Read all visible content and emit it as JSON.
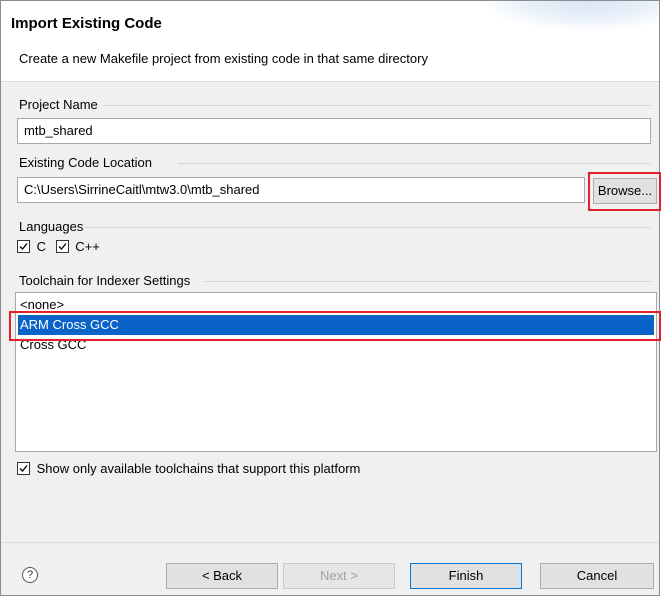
{
  "header": {
    "title": "Import Existing Code",
    "subtitle": "Create a new Makefile project from existing code in that same directory"
  },
  "project_name": {
    "label": "Project Name",
    "value": "mtb_shared"
  },
  "code_location": {
    "label": "Existing Code Location",
    "value": "C:\\Users\\SirrineCaitl\\mtw3.0\\mtb_shared",
    "browse_label": "Browse..."
  },
  "languages": {
    "label": "Languages",
    "items": [
      {
        "label": "C",
        "checked": true
      },
      {
        "label": "C++",
        "checked": true
      }
    ]
  },
  "toolchain": {
    "label": "Toolchain for Indexer Settings",
    "items": [
      {
        "label": "<none>",
        "selected": false
      },
      {
        "label": "ARM Cross GCC",
        "selected": true
      },
      {
        "label": "Cross GCC",
        "selected": false
      }
    ],
    "filter_label": "Show only available toolchains that support this platform",
    "filter_checked": true
  },
  "footer": {
    "help_icon": "question-circle-icon",
    "back_label": "< Back",
    "next_label": "Next >",
    "finish_label": "Finish",
    "cancel_label": "Cancel"
  },
  "colors": {
    "selection": "#0a64c8",
    "highlight_border": "#e0202a"
  }
}
